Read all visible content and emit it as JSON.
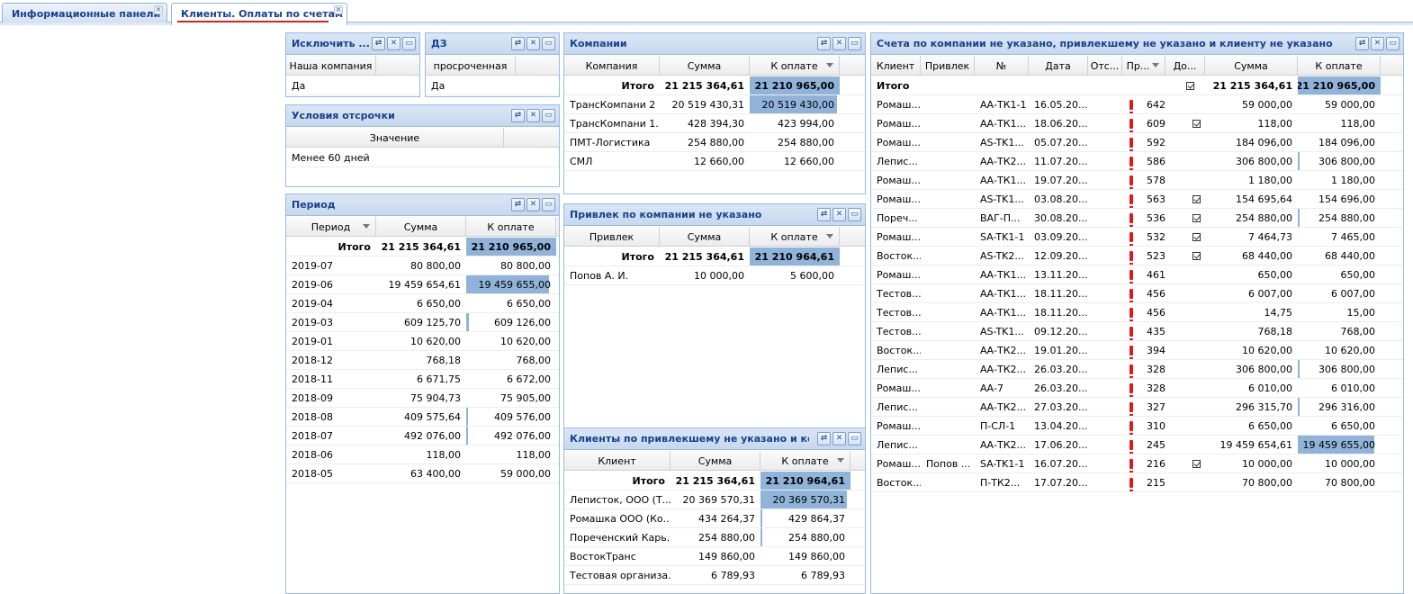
{
  "tabs": [
    {
      "label": "Информационные панели",
      "close": "×"
    },
    {
      "label": "Клиенты. Оплаты по счетам",
      "close": "×"
    }
  ],
  "tools": {
    "refresh": "⇄",
    "excel": "✕",
    "maximize": "▭"
  },
  "panels": {
    "exclude": {
      "title": "Исключить ...",
      "columns": [
        "Наша компания"
      ],
      "rows": [
        [
          "Да"
        ]
      ]
    },
    "dz": {
      "title": "ДЗ",
      "columns": [
        "просроченная"
      ],
      "rows": [
        [
          "Да"
        ]
      ]
    },
    "terms": {
      "title": "Условия отсрочки",
      "columns": [
        "Значение"
      ],
      "rows": [
        [
          "Менее 60 дней"
        ]
      ]
    },
    "period": {
      "title": "Период",
      "columns": [
        "Период",
        "Сумма",
        "К оплате"
      ],
      "total": {
        "label": "Итого",
        "sum": "21 215 364,61",
        "pay": "21 210 965,00",
        "bar": 1.0
      },
      "rows": [
        {
          "p": "2019-07",
          "sum": "80 800,00",
          "pay": "80 800,00",
          "bar": 0
        },
        {
          "p": "2019-06",
          "sum": "19 459 654,61",
          "pay": "19 459 655,00",
          "bar": 0.92
        },
        {
          "p": "2019-04",
          "sum": "6 650,00",
          "pay": "6 650,00",
          "bar": 0
        },
        {
          "p": "2019-03",
          "sum": "609 125,70",
          "pay": "609 126,00",
          "bar": 0.03
        },
        {
          "p": "2019-01",
          "sum": "10 620,00",
          "pay": "10 620,00",
          "bar": 0
        },
        {
          "p": "2018-12",
          "sum": "768,18",
          "pay": "768,00",
          "bar": 0
        },
        {
          "p": "2018-11",
          "sum": "6 671,75",
          "pay": "6 672,00",
          "bar": 0
        },
        {
          "p": "2018-09",
          "sum": "75 904,73",
          "pay": "75 905,00",
          "bar": 0
        },
        {
          "p": "2018-08",
          "sum": "409 575,64",
          "pay": "409 576,00",
          "bar": 0.02
        },
        {
          "p": "2018-07",
          "sum": "492 076,00",
          "pay": "492 076,00",
          "bar": 0.02
        },
        {
          "p": "2018-06",
          "sum": "118,00",
          "pay": "118,00",
          "bar": 0
        },
        {
          "p": "2018-05",
          "sum": "63 400,00",
          "pay": "59 000,00",
          "bar": 0
        }
      ]
    },
    "companies": {
      "title": "Компании",
      "columns": [
        "Компания",
        "Сумма",
        "К оплате"
      ],
      "total": {
        "label": "Итого",
        "sum": "21 215 364,61",
        "pay": "21 210 965,00",
        "bar": 1.0
      },
      "rows": [
        {
          "n": "ТрансКомпани 2",
          "sum": "20 519 430,31",
          "pay": "20 519 430,00",
          "bar": 0.97
        },
        {
          "n": "ТрансКомпани 1...",
          "sum": "428 394,30",
          "pay": "423 994,00",
          "bar": 0
        },
        {
          "n": "ПМТ-Логистика",
          "sum": "254 880,00",
          "pay": "254 880,00",
          "bar": 0
        },
        {
          "n": "СМЛ",
          "sum": "12 660,00",
          "pay": "12 660,00",
          "bar": 0
        }
      ]
    },
    "attractor": {
      "title": "Привлек по компании не указано",
      "columns": [
        "Привлек",
        "Сумма",
        "К оплате"
      ],
      "total": {
        "label": "Итого",
        "sum": "21 215 364,61",
        "pay": "21 210 964,61",
        "bar": 1.0
      },
      "rows": [
        {
          "n": "Попов А. И.",
          "sum": "10 000,00",
          "pay": "5 600,00",
          "bar": 0
        }
      ]
    },
    "clients": {
      "title": "Клиенты по привлекшему не указано и ком...",
      "columns": [
        "Клиент",
        "Сумма",
        "К оплате"
      ],
      "total": {
        "label": "Итого",
        "sum": "21 215 364,61",
        "pay": "21 210 964,61",
        "bar": 1.0
      },
      "rows": [
        {
          "n": "Леписток, ООО (Т...",
          "sum": "20 369 570,31",
          "pay": "20 369 570,31",
          "bar": 0.96
        },
        {
          "n": "Ромашка ООО (Ко...",
          "sum": "434 264,37",
          "pay": "429 864,37",
          "bar": 0.02
        },
        {
          "n": "Пореченский Карь...",
          "sum": "254 880,00",
          "pay": "254 880,00",
          "bar": 0.01
        },
        {
          "n": "ВостокТранс",
          "sum": "149 860,00",
          "pay": "149 860,00",
          "bar": 0
        },
        {
          "n": "Тестовая организа...",
          "sum": "6 789,93",
          "pay": "6 789,93",
          "bar": 0
        }
      ]
    },
    "invoices": {
      "title": "Счета по компании не указано, привлекшему не указано и клиенту не указано",
      "columns": [
        "Клиент",
        "Привлек",
        "№",
        "Дата",
        "Отс...",
        "Пр...",
        "До...",
        "Сумма",
        "К оплате"
      ],
      "total": {
        "label": "Итого",
        "sum": "21 215 364,61",
        "pay": "21 210 965,00",
        "bar": 1.0
      },
      "rows": [
        {
          "c": "Ромаш...",
          "a": "",
          "n": "АА-ТК1-1",
          "d": "16.05.20...",
          "x": true,
          "p": "642",
          "k": false,
          "sum": "59 000,00",
          "pay": "59 000,00",
          "bar": 0
        },
        {
          "c": "Ромаш...",
          "a": "",
          "n": "АА-ТК1...",
          "d": "18.06.20...",
          "x": true,
          "p": "609",
          "k": true,
          "sum": "118,00",
          "pay": "118,00",
          "bar": 0
        },
        {
          "c": "Ромаш...",
          "a": "",
          "n": "AS-TK1...",
          "d": "05.07.20...",
          "x": true,
          "p": "592",
          "k": false,
          "sum": "184 096,00",
          "pay": "184 096,00",
          "bar": 0
        },
        {
          "c": "Лепис...",
          "a": "",
          "n": "АА-ТК2...",
          "d": "11.07.20...",
          "x": true,
          "p": "586",
          "k": false,
          "sum": "306 800,00",
          "pay": "306 800,00",
          "bar": 0.02
        },
        {
          "c": "Ромаш...",
          "a": "",
          "n": "АА-ТК1...",
          "d": "19.07.20...",
          "x": true,
          "p": "578",
          "k": false,
          "sum": "1 180,00",
          "pay": "1 180,00",
          "bar": 0
        },
        {
          "c": "Ромаш...",
          "a": "",
          "n": "AS-TK1...",
          "d": "03.08.20...",
          "x": true,
          "p": "563",
          "k": true,
          "sum": "154 695,64",
          "pay": "154 696,00",
          "bar": 0
        },
        {
          "c": "Пореч...",
          "a": "",
          "n": "ВАГ-П...",
          "d": "30.08.20...",
          "x": true,
          "p": "536",
          "k": true,
          "sum": "254 880,00",
          "pay": "254 880,00",
          "bar": 0.01
        },
        {
          "c": "Ромаш...",
          "a": "",
          "n": "SA-TK1-1",
          "d": "03.09.20...",
          "x": true,
          "p": "532",
          "k": true,
          "sum": "7 464,73",
          "pay": "7 465,00",
          "bar": 0
        },
        {
          "c": "Восток...",
          "a": "",
          "n": "AS-TK2...",
          "d": "12.09.20...",
          "x": true,
          "p": "523",
          "k": true,
          "sum": "68 440,00",
          "pay": "68 440,00",
          "bar": 0
        },
        {
          "c": "Ромаш...",
          "a": "",
          "n": "АА-ТК1...",
          "d": "13.11.20...",
          "x": true,
          "p": "461",
          "k": false,
          "sum": "650,00",
          "pay": "650,00",
          "bar": 0
        },
        {
          "c": "Тестов...",
          "a": "",
          "n": "АА-ТК1...",
          "d": "18.11.20...",
          "x": true,
          "p": "456",
          "k": false,
          "sum": "6 007,00",
          "pay": "6 007,00",
          "bar": 0
        },
        {
          "c": "Тестов...",
          "a": "",
          "n": "АА-ТК1...",
          "d": "18.11.20...",
          "x": true,
          "p": "456",
          "k": false,
          "sum": "14,75",
          "pay": "15,00",
          "bar": 0
        },
        {
          "c": "Тестов...",
          "a": "",
          "n": "AS-TK1...",
          "d": "09.12.20...",
          "x": true,
          "p": "435",
          "k": false,
          "sum": "768,18",
          "pay": "768,00",
          "bar": 0
        },
        {
          "c": "Восток...",
          "a": "",
          "n": "АА-ТК2...",
          "d": "19.01.20...",
          "x": true,
          "p": "394",
          "k": false,
          "sum": "10 620,00",
          "pay": "10 620,00",
          "bar": 0
        },
        {
          "c": "Лепис...",
          "a": "",
          "n": "АА-ТК2...",
          "d": "26.03.20...",
          "x": true,
          "p": "328",
          "k": false,
          "sum": "306 800,00",
          "pay": "306 800,00",
          "bar": 0.02
        },
        {
          "c": "Ромаш...",
          "a": "",
          "n": "АА-7",
          "d": "26.03.20...",
          "x": true,
          "p": "328",
          "k": false,
          "sum": "6 010,00",
          "pay": "6 010,00",
          "bar": 0
        },
        {
          "c": "Лепис...",
          "a": "",
          "n": "АА-ТК2...",
          "d": "27.03.20...",
          "x": true,
          "p": "327",
          "k": false,
          "sum": "296 315,70",
          "pay": "296 316,00",
          "bar": 0.02
        },
        {
          "c": "Ромаш...",
          "a": "",
          "n": "П-СЛ-1",
          "d": "13.04.20...",
          "x": true,
          "p": "310",
          "k": false,
          "sum": "6 650,00",
          "pay": "6 650,00",
          "bar": 0
        },
        {
          "c": "Лепис...",
          "a": "",
          "n": "АА-ТК2...",
          "d": "17.06.20...",
          "x": true,
          "p": "245",
          "k": false,
          "sum": "19 459 654,61",
          "pay": "19 459 655,00",
          "bar": 0.92
        },
        {
          "c": "Ромаш...",
          "a": "Попов ...",
          "n": "SA-TK1-1",
          "d": "16.07.20...",
          "x": true,
          "p": "216",
          "k": true,
          "sum": "10 000,00",
          "pay": "10 000,00",
          "bar": 0
        },
        {
          "c": "Восток...",
          "a": "",
          "n": "П-ТК2...",
          "d": "17.07.20...",
          "x": true,
          "p": "215",
          "k": false,
          "sum": "70 800,00",
          "pay": "70 800,00",
          "bar": 0
        }
      ]
    }
  }
}
